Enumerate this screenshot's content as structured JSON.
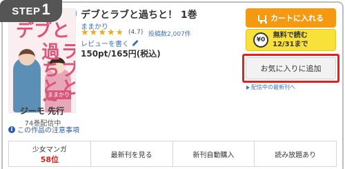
{
  "step_badge": {
    "prefix": "STEP",
    "number": "1"
  },
  "book": {
    "title": "デブとラブと過ちと！ 1巻",
    "author": "ままかり",
    "rating": "(4.7)",
    "stars_value": 4.7,
    "review_count": "投稿数2,007件",
    "review_link": "レビューを書く",
    "price": "150pt/165円(税込)",
    "cover": {
      "title_line1": "デブと",
      "title_line2": "ラブと過ちと!",
      "author_tag": "ままかり",
      "bottom_author": "ジーモ 先行"
    },
    "volumes": "74巻配信中",
    "notes_link": "この作品の注意事項"
  },
  "actions": {
    "cart": "カートに入れる",
    "free_line1": "無料で読む",
    "free_line2": "12/31まで",
    "coin_label": "¥0",
    "favorite": "お気に入りに追加",
    "delivery_link": "配信中の最新刊へ"
  },
  "bottom_bar": {
    "genre": "少女マンガ",
    "rank": "58位",
    "latest": "最新刊を見る",
    "auto_buy": "新刊自動購入",
    "unlimited": "読み放題あり"
  },
  "colors": {
    "accent_orange": "#f39a12",
    "free_yellow": "#f8e13b",
    "highlight_red": "#e3201b",
    "link_blue": "#3f73b6"
  }
}
